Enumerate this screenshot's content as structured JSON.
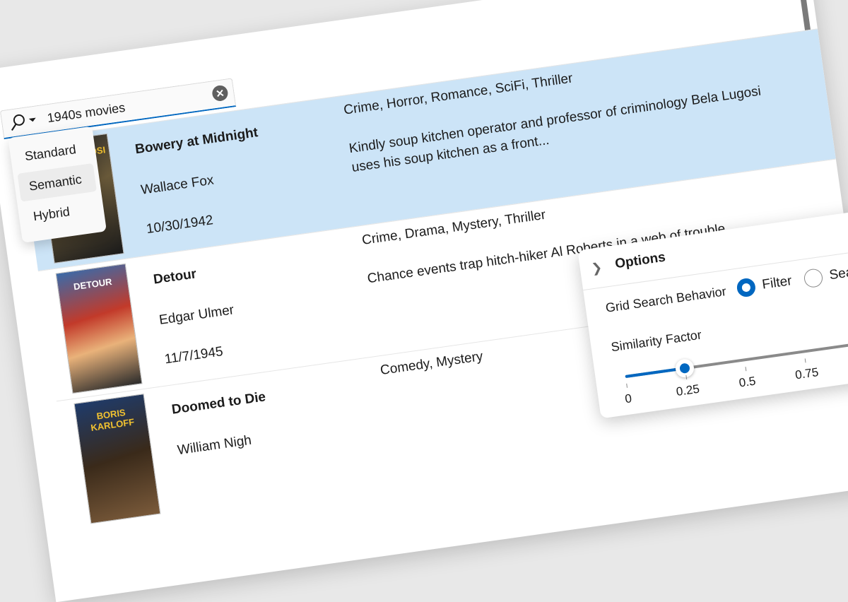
{
  "search": {
    "value": "1940s movies",
    "mode_options": [
      "Standard",
      "Semantic",
      "Hybrid"
    ],
    "selected_mode": "Semantic"
  },
  "movies": [
    {
      "title": "Bowery at Midnight",
      "director": "Wallace Fox",
      "date": "10/30/1942",
      "genre": "Crime, Horror, Romance, SciFi, Thriller",
      "description": "Kindly soup kitchen operator and professor of criminology Bela Lugosi uses his soup kitchen as a front...",
      "poster_text": "BELA LUGOSI",
      "selected": true
    },
    {
      "title": "Detour",
      "director": "Edgar Ulmer",
      "date": "11/7/1945",
      "genre": "Crime, Drama, Mystery, Thriller",
      "description": "Chance events trap hitch-hiker Al Roberts in a web of trouble.",
      "poster_text": "DETOUR",
      "selected": false
    },
    {
      "title": "Doomed to Die",
      "director": "William Nigh",
      "date": "",
      "genre": "Comedy, Mystery",
      "description": "",
      "poster_text": "BORIS KARLOFF",
      "selected": false
    }
  ],
  "options": {
    "title": "Options",
    "behavior_label": "Grid Search Behavior",
    "behavior_options": [
      "Filter",
      "Search"
    ],
    "behavior_selected": "Filter",
    "similarity_label": "Similarity Factor",
    "similarity_value": 0.25,
    "ticks": [
      "0",
      "0.25",
      "0.5",
      "0.75"
    ]
  },
  "colors": {
    "accent": "#0067c0",
    "selected_row": "#cce4f7"
  },
  "icons": {
    "search": "magnifier-icon",
    "clear": "clear-circle-icon",
    "expand": "chevron-right-icon"
  }
}
